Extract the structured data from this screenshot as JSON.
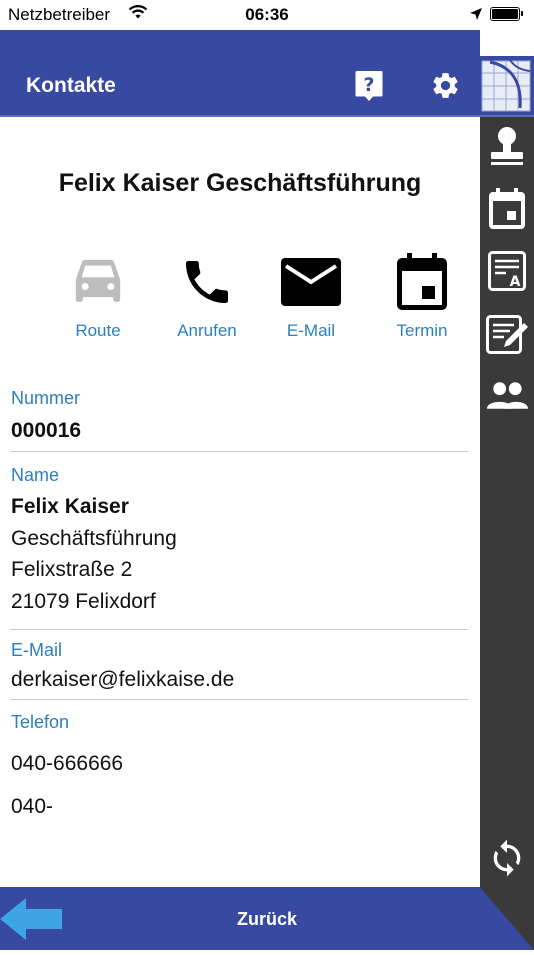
{
  "status_bar": {
    "carrier": "Netzbetreiber",
    "time": "06:36"
  },
  "header": {
    "title": "Kontakte",
    "icons": [
      "help-icon",
      "gear-icon",
      "logo-icon"
    ]
  },
  "contact": {
    "title": "Felix Kaiser Geschäftsführung"
  },
  "actions": [
    {
      "label": "Route",
      "icon": "car-icon",
      "color": "#bdbdbd"
    },
    {
      "label": "Anrufen",
      "icon": "phone-icon",
      "color": "#000000"
    },
    {
      "label": "E-Mail",
      "icon": "mail-icon",
      "color": "#000000"
    },
    {
      "label": "Termin",
      "icon": "calendar-icon",
      "color": "#000000"
    }
  ],
  "fields": {
    "nummer": {
      "label": "Nummer",
      "value": "000016"
    },
    "name": {
      "label": "Name",
      "lines": [
        "Felix Kaiser",
        "Geschäftsführung",
        "Felixstraße 2",
        "21079 Felixdorf"
      ]
    },
    "email": {
      "label": "E-Mail",
      "value": "derkaiser@felixkaise.de"
    },
    "telefon": {
      "label": "Telefon",
      "values": [
        "040-666666",
        "040-"
      ]
    }
  },
  "rail_icons": [
    "stamp-icon",
    "calendar-icon",
    "document-icon",
    "edit-icon",
    "people-icon",
    "sync-icon"
  ],
  "bottom_bar": {
    "back_label": "Zurück"
  },
  "colors": {
    "primary": "#3749a1",
    "accent": "#2a7fc1",
    "rail": "#3a3a3a",
    "back_arrow": "#3ea4e4"
  }
}
